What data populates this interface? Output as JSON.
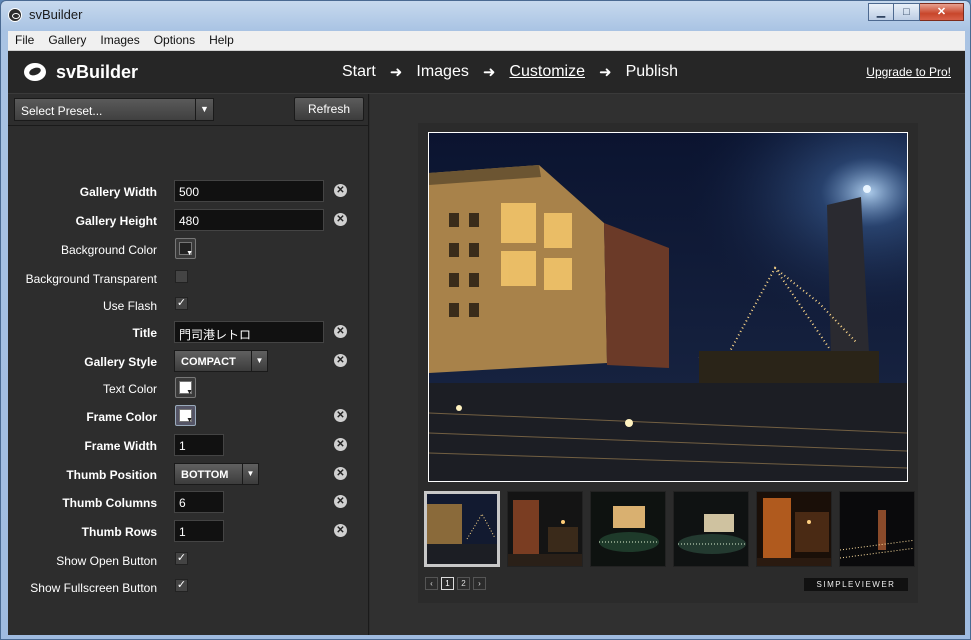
{
  "window": {
    "title": "svBuilder",
    "btn_minimize": "▁",
    "btn_maximize": "□",
    "btn_close": "✕"
  },
  "menu": [
    "File",
    "Gallery",
    "Images",
    "Options",
    "Help"
  ],
  "header": {
    "logo_text": "svBuilder",
    "steps": [
      "Start",
      "Images",
      "Customize",
      "Publish"
    ],
    "active_step": "Customize",
    "upgrade_link": "Upgrade to Pro!"
  },
  "left_panel": {
    "preset_placeholder": "Select Preset...",
    "refresh_label": "Refresh",
    "settings": {
      "gallery_width": {
        "label": "Gallery Width",
        "value": "500"
      },
      "gallery_height": {
        "label": "Gallery Height",
        "value": "480"
      },
      "background_color": {
        "label": "Background Color",
        "color": "#222222"
      },
      "background_transparent": {
        "label": "Background Transparent",
        "checked": false
      },
      "use_flash": {
        "label": "Use Flash",
        "checked": true
      },
      "title": {
        "label": "Title",
        "value": "門司港レトロ"
      },
      "gallery_style": {
        "label": "Gallery Style",
        "value": "COMPACT"
      },
      "text_color": {
        "label": "Text Color",
        "color": "#ffffff"
      },
      "frame_color": {
        "label": "Frame Color",
        "color": "#ffffff"
      },
      "frame_width": {
        "label": "Frame Width",
        "value": "1"
      },
      "thumb_position": {
        "label": "Thumb Position",
        "value": "BOTTOM"
      },
      "thumb_columns": {
        "label": "Thumb Columns",
        "value": "6"
      },
      "thumb_rows": {
        "label": "Thumb Rows",
        "value": "1"
      },
      "show_open_button": {
        "label": "Show Open Button",
        "checked": true
      },
      "show_fullscreen_button": {
        "label": "Show Fullscreen Button",
        "checked": true
      }
    },
    "clear_glyph": "✕",
    "check_glyph": "✓"
  },
  "preview": {
    "pages": [
      "‹",
      "1",
      "2",
      "›"
    ],
    "current_page": "1",
    "badge": "SIMPLEVIEWER",
    "thumb_count": 6,
    "selected_thumb": 1
  },
  "colors": {
    "panel_bg": "#2d2d2d",
    "accent": "#ffffff",
    "titlebar": "#a9c3e3"
  }
}
